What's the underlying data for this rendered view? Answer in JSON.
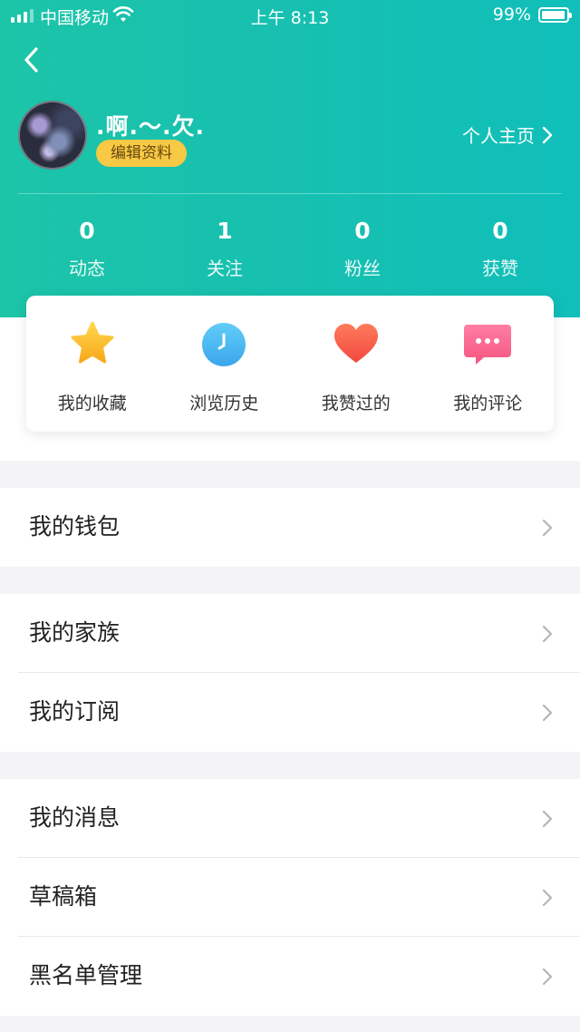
{
  "status_bar": {
    "carrier": "中国移动",
    "time": "上午 8:13",
    "battery": "99%"
  },
  "profile": {
    "nickname": ".啊.～.欠.",
    "edit_label": "编辑资料",
    "homepage_label": "个人主页"
  },
  "stats": [
    {
      "value": "0",
      "label": "动态"
    },
    {
      "value": "1",
      "label": "关注"
    },
    {
      "value": "0",
      "label": "粉丝"
    },
    {
      "value": "0",
      "label": "获赞"
    }
  ],
  "quick_actions": [
    {
      "label": "我的收藏",
      "icon": "star-icon"
    },
    {
      "label": "浏览历史",
      "icon": "clock-icon"
    },
    {
      "label": "我赞过的",
      "icon": "heart-icon"
    },
    {
      "label": "我的评论",
      "icon": "comment-icon"
    }
  ],
  "menu": {
    "group1": [
      {
        "label": "我的钱包"
      }
    ],
    "group2": [
      {
        "label": "我的家族"
      },
      {
        "label": "我的订阅"
      }
    ],
    "group3": [
      {
        "label": "我的消息"
      },
      {
        "label": "草稿箱"
      },
      {
        "label": "黑名单管理"
      }
    ]
  },
  "colors": {
    "header_start": "#1cc4a8",
    "header_end": "#10bfba",
    "badge": "#f7c944",
    "background": "#f4f4f6"
  }
}
